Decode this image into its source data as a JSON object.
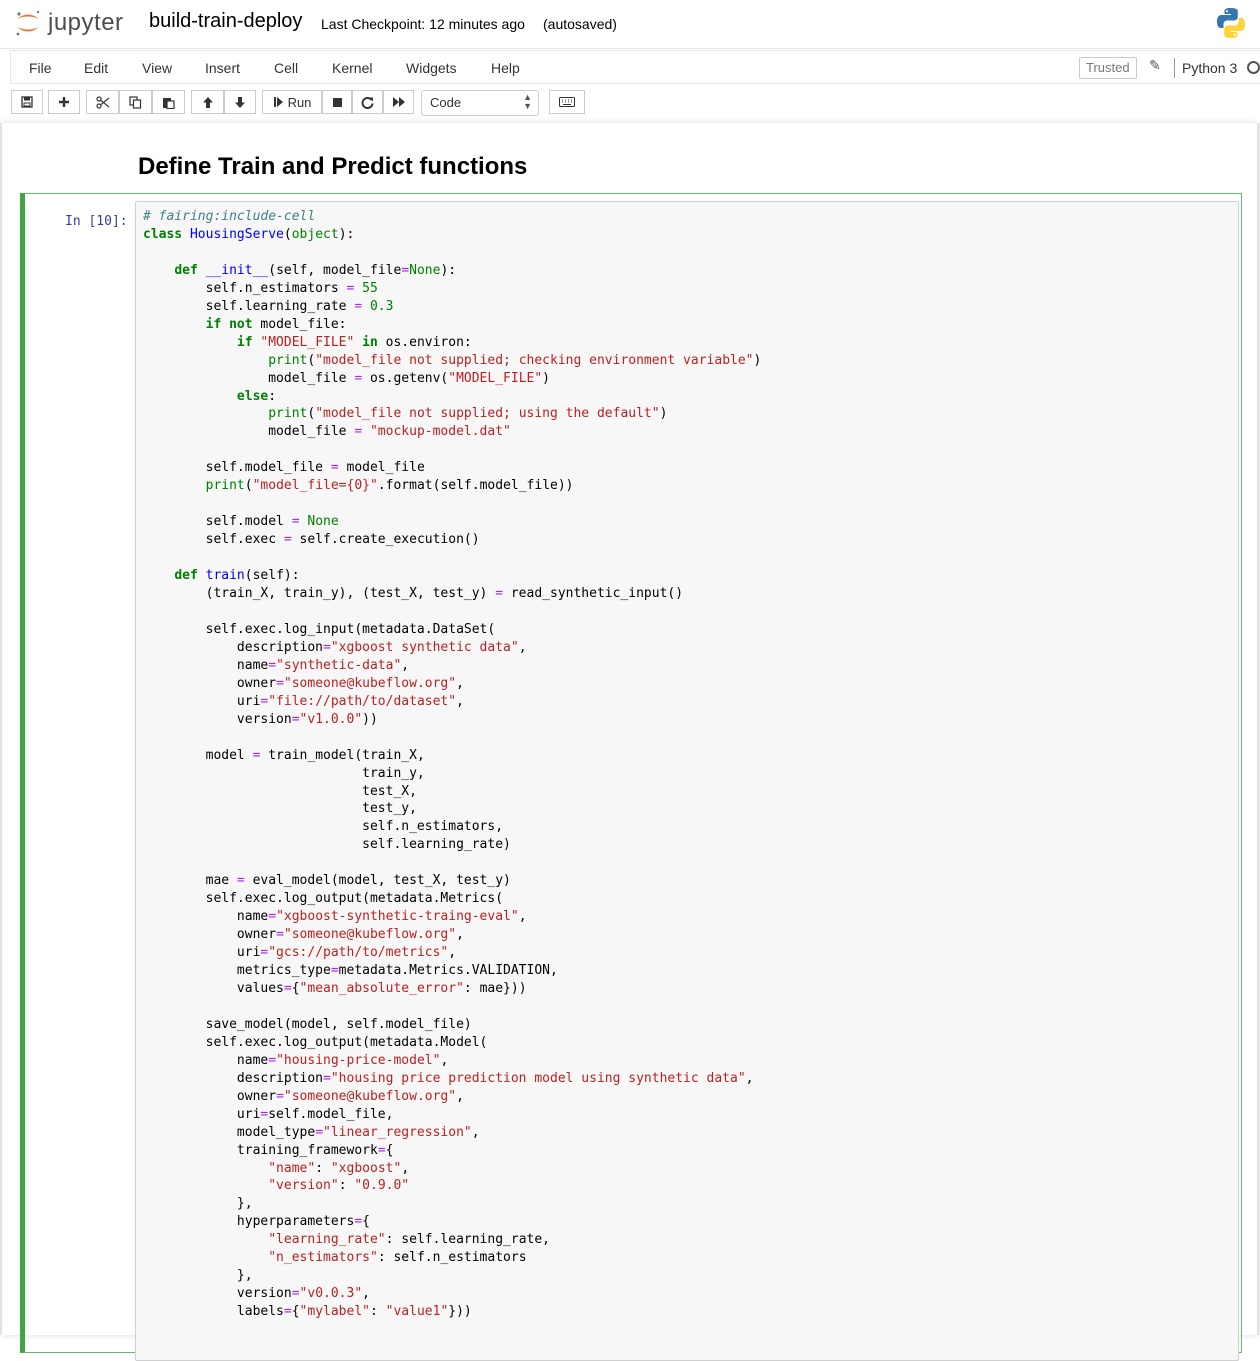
{
  "header": {
    "logo_text": "jupyter",
    "notebook_title": "build-train-deploy",
    "checkpoint": "Last Checkpoint: 12 minutes ago",
    "autosave": "(autosaved)"
  },
  "menubar": {
    "items": [
      "File",
      "Edit",
      "View",
      "Insert",
      "Cell",
      "Kernel",
      "Widgets",
      "Help"
    ],
    "trusted_label": "Trusted",
    "kernel_name": "Python 3"
  },
  "toolbar": {
    "run_label": "Run",
    "cell_type": "Code",
    "icons": [
      "save-icon",
      "plus-icon",
      "cut-icon",
      "copy-icon",
      "paste-icon",
      "arrow-up-icon",
      "arrow-down-icon",
      "step-forward-icon",
      "stop-icon",
      "restart-icon",
      "fast-forward-icon",
      "keyboard-icon"
    ]
  },
  "notebook": {
    "heading": "Define Train and Predict functions",
    "cell": {
      "prompt": "In [10]:",
      "code_lines": [
        "# fairing:include-cell",
        "class HousingServe(object):",
        "",
        "    def __init__(self, model_file=None):",
        "        self.n_estimators = 55",
        "        self.learning_rate = 0.3",
        "        if not model_file:",
        "            if \"MODEL_FILE\" in os.environ:",
        "                print(\"model_file not supplied; checking environment variable\")",
        "                model_file = os.getenv(\"MODEL_FILE\")",
        "            else:",
        "                print(\"model_file not supplied; using the default\")",
        "                model_file = \"mockup-model.dat\"",
        "",
        "        self.model_file = model_file",
        "        print(\"model_file={0}\".format(self.model_file))",
        "",
        "        self.model = None",
        "        self.exec = self.create_execution()",
        "",
        "    def train(self):",
        "        (train_X, train_y), (test_X, test_y) = read_synthetic_input()",
        "",
        "        self.exec.log_input(metadata.DataSet(",
        "            description=\"xgboost synthetic data\",",
        "            name=\"synthetic-data\",",
        "            owner=\"someone@kubeflow.org\",",
        "            uri=\"file://path/to/dataset\",",
        "            version=\"v1.0.0\"))",
        "",
        "        model = train_model(train_X,",
        "                            train_y,",
        "                            test_X,",
        "                            test_y,",
        "                            self.n_estimators,",
        "                            self.learning_rate)",
        "",
        "        mae = eval_model(model, test_X, test_y)",
        "        self.exec.log_output(metadata.Metrics(",
        "            name=\"xgboost-synthetic-traing-eval\",",
        "            owner=\"someone@kubeflow.org\",",
        "            uri=\"gcs://path/to/metrics\",",
        "            metrics_type=metadata.Metrics.VALIDATION,",
        "            values={\"mean_absolute_error\": mae}))",
        "",
        "        save_model(model, self.model_file)",
        "        self.exec.log_output(metadata.Model(",
        "            name=\"housing-price-model\",",
        "            description=\"housing price prediction model using synthetic data\",",
        "            owner=\"someone@kubeflow.org\",",
        "            uri=self.model_file,",
        "            model_type=\"linear_regression\",",
        "            training_framework={",
        "                \"name\": \"xgboost\",",
        "                \"version\": \"0.9.0\"",
        "            },",
        "            hyperparameters={",
        "                \"learning_rate\": self.learning_rate,",
        "                \"n_estimators\": self.n_estimators",
        "            },",
        "            version=\"v0.0.3\",",
        "            labels={\"mylabel\": \"value1\"}))"
      ]
    }
  }
}
